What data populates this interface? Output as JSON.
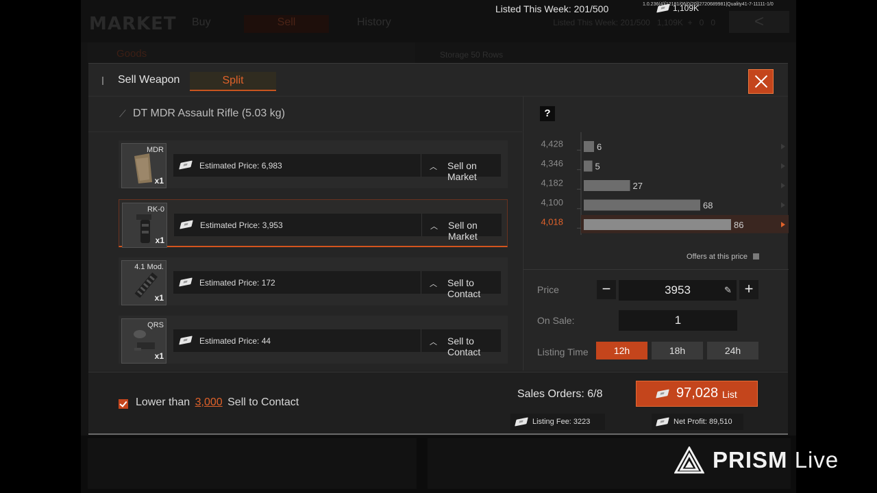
{
  "background": {
    "logo": "MARKET",
    "tabs": [
      {
        "label": "Buy"
      },
      {
        "label": "Sell"
      },
      {
        "label": "History"
      }
    ],
    "stats": {
      "listed_week": "Listed This Week: 201/500",
      "coins": "1,109K",
      "plus": "+",
      "c1": "0",
      "c2": "0"
    },
    "back_label": "<",
    "goods_label": "Goods",
    "storage_label": "Storage",
    "storage_rows": "50 Rows"
  },
  "overlay": {
    "listed_week": "Listed This Week: 201/500",
    "build_info": "1.0.236(4)[12181/06/0/20]|2720689981|Quality41-7-11111-1/0",
    "coins": "1,109K"
  },
  "modal": {
    "title": "Sell Weapon",
    "split_tab": "Split",
    "weapon_name": "DT MDR Assault Rifle (5.03 kg)",
    "items": [
      {
        "name": "MDR",
        "qty": "x1",
        "estimate": "Estimated Price: 6,983",
        "action": "Sell on Market",
        "selected": false
      },
      {
        "name": "RK-0",
        "qty": "x1",
        "estimate": "Estimated Price: 3,953",
        "action": "Sell on Market",
        "selected": true
      },
      {
        "name": "4.1 Mod.",
        "qty": "x1",
        "estimate": "Estimated Price: 172",
        "action": "Sell to Contact",
        "selected": false
      },
      {
        "name": "QRS",
        "qty": "x1",
        "estimate": "Estimated Price: 44",
        "action": "Sell to Contact",
        "selected": false
      }
    ],
    "help": "?",
    "offers_label": "Offers at this price",
    "price_label": "Price",
    "price_value": "3953",
    "minus": "−",
    "plus": "+",
    "onsale_label": "On Sale:",
    "onsale_value": "1",
    "listing_time_label": "Listing Time",
    "listing_times": [
      "12h",
      "18h",
      "24h"
    ],
    "listing_time_active": "12h",
    "footer": {
      "lower_prefix": "Lower than",
      "lower_value": "3,000",
      "lower_suffix": "Sell to Contact",
      "sales_orders": "Sales Orders: 6/8",
      "list_amount": "97,028",
      "list_word": "List",
      "listing_fee": "Listing Fee: 3223",
      "net_profit": "Net Profit: 89,510"
    }
  },
  "chart_data": {
    "type": "bar",
    "orientation": "horizontal",
    "categories": [
      "4,428",
      "4,346",
      "4,182",
      "4,100",
      "4,018"
    ],
    "values": [
      6,
      5,
      27,
      68,
      86
    ],
    "highlighted_category": "4,018",
    "xlim": [
      0,
      100
    ],
    "colors": {
      "bar": "#6d6d6d",
      "highlight": "#e0622a",
      "highlight_row": "#3a2620"
    }
  },
  "watermark": {
    "brand": "PRISM",
    "suffix": "Live"
  },
  "colors": {
    "accent": "#c4451c",
    "accent_text": "#e0622a"
  }
}
